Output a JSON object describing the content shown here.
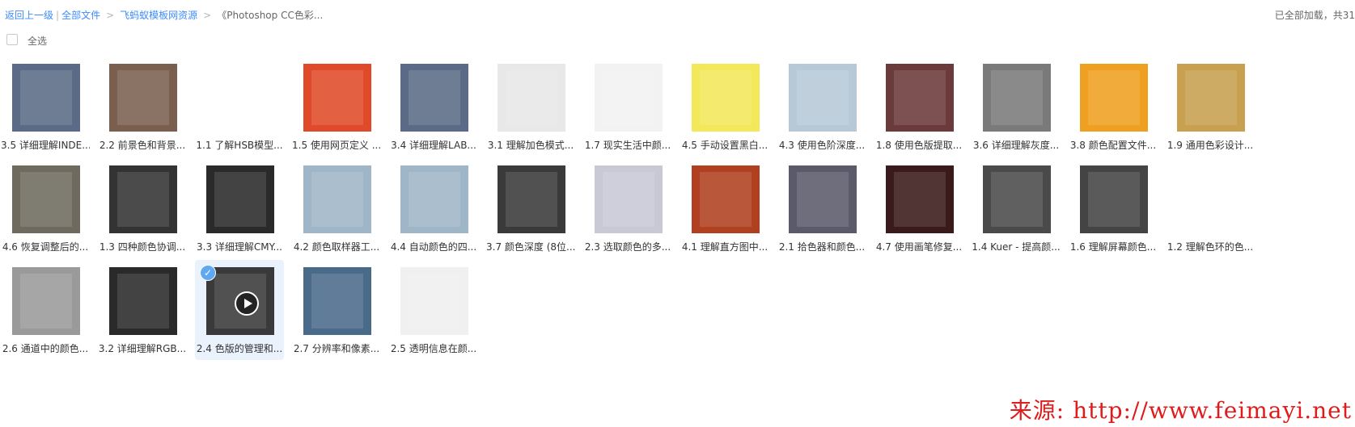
{
  "breadcrumb": {
    "back": "返回上一级",
    "all_files": "全部文件",
    "folder": "飞蚂蚁模板网资源",
    "current": "《Photoshop CC色彩..."
  },
  "load_status": "已全部加载，共31",
  "select_all_label": "全选",
  "files": [
    {
      "name": "3.5 详细理解INDE...",
      "bg": "#5b6a86"
    },
    {
      "name": "2.2 前景色和背景...",
      "bg": "#7a5f4f"
    },
    {
      "name": "1.1 了解HSB模型...",
      "bg": "#ffffff"
    },
    {
      "name": "1.5 使用网页定义 ...",
      "bg": "#e04a2a"
    },
    {
      "name": "3.4 详细理解LAB...",
      "bg": "#5b6a86"
    },
    {
      "name": "3.1 理解加色模式...",
      "bg": "#e8e8e8"
    },
    {
      "name": "1.7 现实生活中颜...",
      "bg": "#f2f2f2"
    },
    {
      "name": "4.5 手动设置黑白...",
      "bg": "#f3e85a"
    },
    {
      "name": "4.3 使用色阶深度...",
      "bg": "#b7c9d6"
    },
    {
      "name": "1.8 使用色版提取...",
      "bg": "#6b3a3a"
    },
    {
      "name": "3.6 详细理解灰度...",
      "bg": "#7a7a7a"
    },
    {
      "name": "3.8 颜色配置文件...",
      "bg": "#f0a020"
    },
    {
      "name": "1.9 通用色彩设计...",
      "bg": "#c8a050"
    },
    {
      "name": "4.6 恢复调整后的...",
      "bg": "#6e6a5e"
    },
    {
      "name": "1.3 四种颜色协调...",
      "bg": "#333333"
    },
    {
      "name": "3.3 详细理解CMY...",
      "bg": "#2a2a2a"
    },
    {
      "name": "4.2 颜色取样器工...",
      "bg": "#9fb6c8"
    },
    {
      "name": "4.4 自动颜色的四...",
      "bg": "#9fb6c8"
    },
    {
      "name": "3.7 颜色深度 (8位...",
      "bg": "#3a3a3a"
    },
    {
      "name": "2.3 选取颜色的多...",
      "bg": "#c9c9d6"
    },
    {
      "name": "4.1 理解直方图中...",
      "bg": "#b04020"
    },
    {
      "name": "2.1 拾色器和颜色...",
      "bg": "#5a5a6a"
    },
    {
      "name": "4.7 使用画笔修复...",
      "bg": "#3a1a1a"
    },
    {
      "name": "1.4 Kuer - 提高颜...",
      "bg": "#4a4a4a"
    },
    {
      "name": "1.6 理解屏幕颜色...",
      "bg": "#444444"
    },
    {
      "name": "1.2 理解色环的色...",
      "bg": "#ffffff"
    },
    {
      "name": "2.6 通道中的颜色...",
      "bg": "#9a9a9a"
    },
    {
      "name": "3.2 详细理解RGB...",
      "bg": "#2a2a2a"
    },
    {
      "name": "2.4 色版的管理和...",
      "bg": "#3a3a3a",
      "selected": true,
      "video": true
    },
    {
      "name": "2.7 分辨率和像素...",
      "bg": "#4a6a8a"
    },
    {
      "name": "2.5 透明信息在颜...",
      "bg": "#f0f0f0"
    }
  ],
  "watermark": "来源: http://www.feimayi.net"
}
